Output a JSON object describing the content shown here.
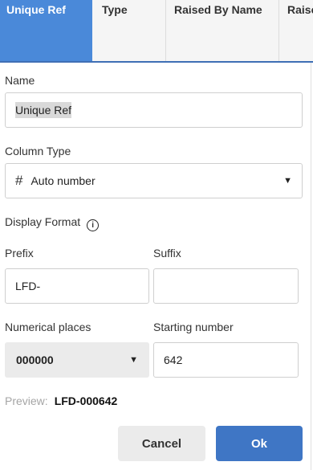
{
  "table_header": {
    "columns": [
      "Unique Ref",
      "Type",
      "Raised By Name",
      "Raise"
    ]
  },
  "dialog": {
    "name_label": "Name",
    "name_value": "Unique Ref",
    "column_type_label": "Column Type",
    "column_type_value": "Auto number",
    "display_format_label": "Display Format",
    "prefix_label": "Prefix",
    "prefix_value": "LFD-",
    "suffix_label": "Suffix",
    "suffix_value": "",
    "numerical_places_label": "Numerical places",
    "numerical_places_value": "000000",
    "starting_number_label": "Starting number",
    "starting_number_value": "642",
    "preview_label": "Preview:",
    "preview_value": "LFD-000642",
    "cancel_label": "Cancel",
    "ok_label": "Ok"
  },
  "icons": {
    "type_icon": "hash-icon",
    "info_icon": "info-icon",
    "dropdown_icon": "caret-down-icon"
  },
  "colors": {
    "accent": "#3f76c5",
    "active_header": "#4a89d9"
  }
}
